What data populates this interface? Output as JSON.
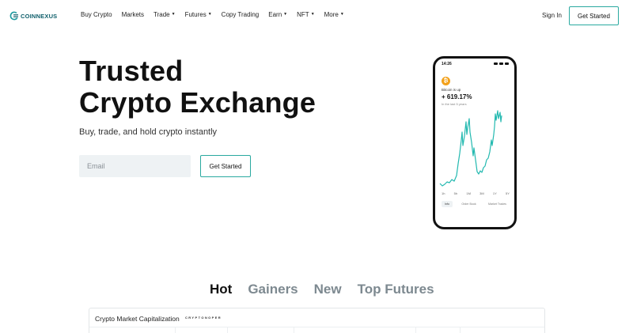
{
  "brand": {
    "name": "COINNEXUS",
    "color": "#0f5f6b",
    "accent": "#2aa9a0"
  },
  "nav": {
    "links": [
      {
        "label": "Buy Crypto",
        "dropdown": false
      },
      {
        "label": "Markets",
        "dropdown": false
      },
      {
        "label": "Trade",
        "dropdown": true
      },
      {
        "label": "Futures",
        "dropdown": true
      },
      {
        "label": "Copy Trading",
        "dropdown": false
      },
      {
        "label": "Earn",
        "dropdown": true
      },
      {
        "label": "NFT",
        "dropdown": true
      },
      {
        "label": "More",
        "dropdown": true
      }
    ],
    "signin": "Sign In",
    "cta": "Get Started"
  },
  "hero": {
    "title_line1": "Trusted",
    "title_line2": "Crypto Exchange",
    "subtitle": "Buy, trade, and hold crypto instantly",
    "email_placeholder": "Email",
    "cta": "Get Started"
  },
  "phone": {
    "time": "14:26",
    "coin_symbol": "₿",
    "coin_text": "Bitcoin is up",
    "change": "+ 619.17%",
    "period": "In the last 5 years",
    "ranges": [
      "1h",
      "5h",
      "1M",
      "3M",
      "1Y",
      "5Y"
    ],
    "tabs": [
      "Info",
      "Order Book",
      "Market Trades"
    ],
    "active_tab": "Info",
    "line_color": "#23b9b0"
  },
  "categories": {
    "tabs": [
      "Hot",
      "Gainers",
      "New",
      "Top Futures"
    ],
    "active": "Hot"
  },
  "market_card": {
    "title": "Crypto Market Capitalization",
    "brand_text": "CRYPTONOPER"
  }
}
